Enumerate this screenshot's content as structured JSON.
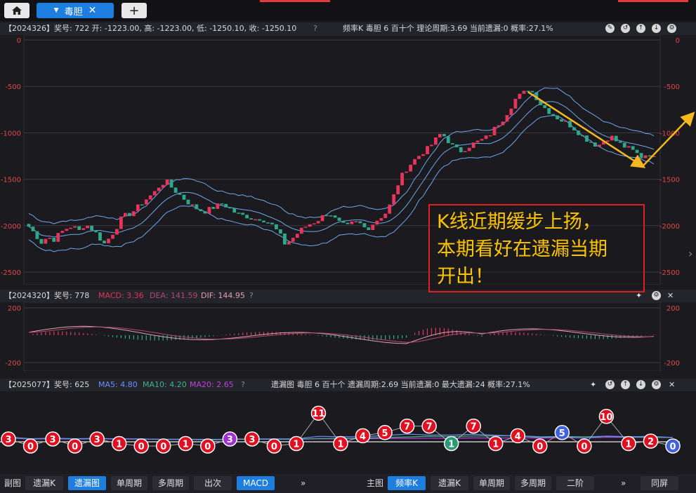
{
  "tabs": {
    "home_icon": "home-icon",
    "active_label": "毒胆",
    "close_glyph": "✕",
    "add_glyph": "+",
    "dropdown_glyph": "▼"
  },
  "main_panel": {
    "header": "【2024326】奖号: 722  开: -1223.00, 高: -1223.00, 低: -1250.10, 收: -1250.10",
    "info": "频率K   毒胆   6   百十个   理论周期:3.69   当前遗漏:0   概率:27.1%",
    "yticks": [
      "0",
      "-500",
      "-1000",
      "-1500",
      "-2000",
      "-2500"
    ]
  },
  "macd_panel": {
    "header_prefix": "【2024320】奖号: 778",
    "macd": "MACD: 3.36",
    "dea": "DEA: 141.59",
    "dif": "DIF: 144.95",
    "yticks": [
      "200",
      "-200"
    ]
  },
  "miss_panel": {
    "header_prefix": "【2025077】奖号: 625",
    "ma5": "MA5: 4.80",
    "ma10": "MA10: 4.20",
    "ma20": "MA20: 2.65",
    "info": "遗漏图   毒胆   6   百十个   遗漏周期:2.69   当前遗漏:0   最大遗漏:24   概率:27.1%"
  },
  "annotation": {
    "line1": "K线近期缓步上扬，",
    "line2": "本期看好在遗漏当期",
    "line3": "开出！"
  },
  "bottom": {
    "left_label": "副图",
    "left_buttons": [
      "遗漏K",
      "遗漏图",
      "单周期",
      "多周期",
      "出次",
      "MACD"
    ],
    "more": "»",
    "right_label": "主图",
    "right_buttons": [
      "频率K",
      "遗漏K",
      "单周期",
      "多周期",
      "二阶"
    ],
    "more2": "»",
    "fullscreen": "同屏"
  },
  "colors": {
    "up": "#e8335a",
    "down": "#2ea88a",
    "band": "#6fa8e8",
    "accent": "#1e7ee0",
    "annot_text": "#ffc400",
    "annot_border": "#e02020",
    "arrow": "#f5b820"
  },
  "chart_data": [
    {
      "type": "candlestick",
      "title": "频率K",
      "ylim": [
        -2500,
        0
      ],
      "yticks": [
        0,
        -500,
        -1000,
        -1500,
        -2000,
        -2500
      ],
      "close_path": [
        -2010,
        -2090,
        -2180,
        -2120,
        -2150,
        -2080,
        -2030,
        -2000,
        -2060,
        -1980,
        -2030,
        -2100,
        -2200,
        -2120,
        -2020,
        -1900,
        -1880,
        -1830,
        -1760,
        -1700,
        -1650,
        -1560,
        -1520,
        -1600,
        -1660,
        -1720,
        -1780,
        -1820,
        -1850,
        -1820,
        -1790,
        -1760,
        -1810,
        -1860,
        -1890,
        -1900,
        -1930,
        -1920,
        -1950,
        -2000,
        -2080,
        -2200,
        -2150,
        -2080,
        -2020,
        -1980,
        -1950,
        -1900,
        -1850,
        -1930,
        -1990,
        -2010,
        -1960,
        -1980,
        -2040,
        -1980,
        -1920,
        -1870,
        -1750,
        -1560,
        -1420,
        -1340,
        -1270,
        -1210,
        -1160,
        -1080,
        -1000,
        -1080,
        -1160,
        -1200,
        -1160,
        -1120,
        -1090,
        -1060,
        -1000,
        -910,
        -840,
        -730,
        -620,
        -580,
        -520,
        -600,
        -700,
        -760,
        -810,
        -860,
        -890,
        -940,
        -1000,
        -1060,
        -1100,
        -1140,
        -1090,
        -1030,
        -1090,
        -1140,
        -1170,
        -1210,
        -1260,
        -1220,
        -1250
      ],
      "last": {
        "open": -1223.0,
        "high": -1223.0,
        "low": -1250.1,
        "close": -1250.1
      }
    },
    {
      "type": "bar",
      "title": "MACD",
      "ylim": [
        -200,
        200
      ],
      "series": [
        {
          "name": "DIF",
          "last": 144.95
        },
        {
          "name": "DEA",
          "last": 141.59
        },
        {
          "name": "MACD",
          "last": 3.36
        }
      ]
    },
    {
      "type": "line",
      "title": "遗漏图",
      "values": [
        3,
        0,
        3,
        0,
        3,
        1,
        0,
        0,
        1,
        0,
        3,
        3,
        0,
        1,
        11,
        1,
        4,
        5,
        7,
        7,
        1,
        7,
        1,
        4,
        0,
        5,
        0,
        10,
        1,
        2,
        0
      ],
      "colors_key": [
        "r",
        "r",
        "r",
        "r",
        "r",
        "r",
        "r",
        "r",
        "r",
        "r",
        "p",
        "r",
        "r",
        "r",
        "r",
        "r",
        "r",
        "r",
        "r",
        "r",
        "g",
        "r",
        "r",
        "r",
        "r",
        "b",
        "r",
        "r",
        "r",
        "r",
        "b"
      ]
    }
  ]
}
